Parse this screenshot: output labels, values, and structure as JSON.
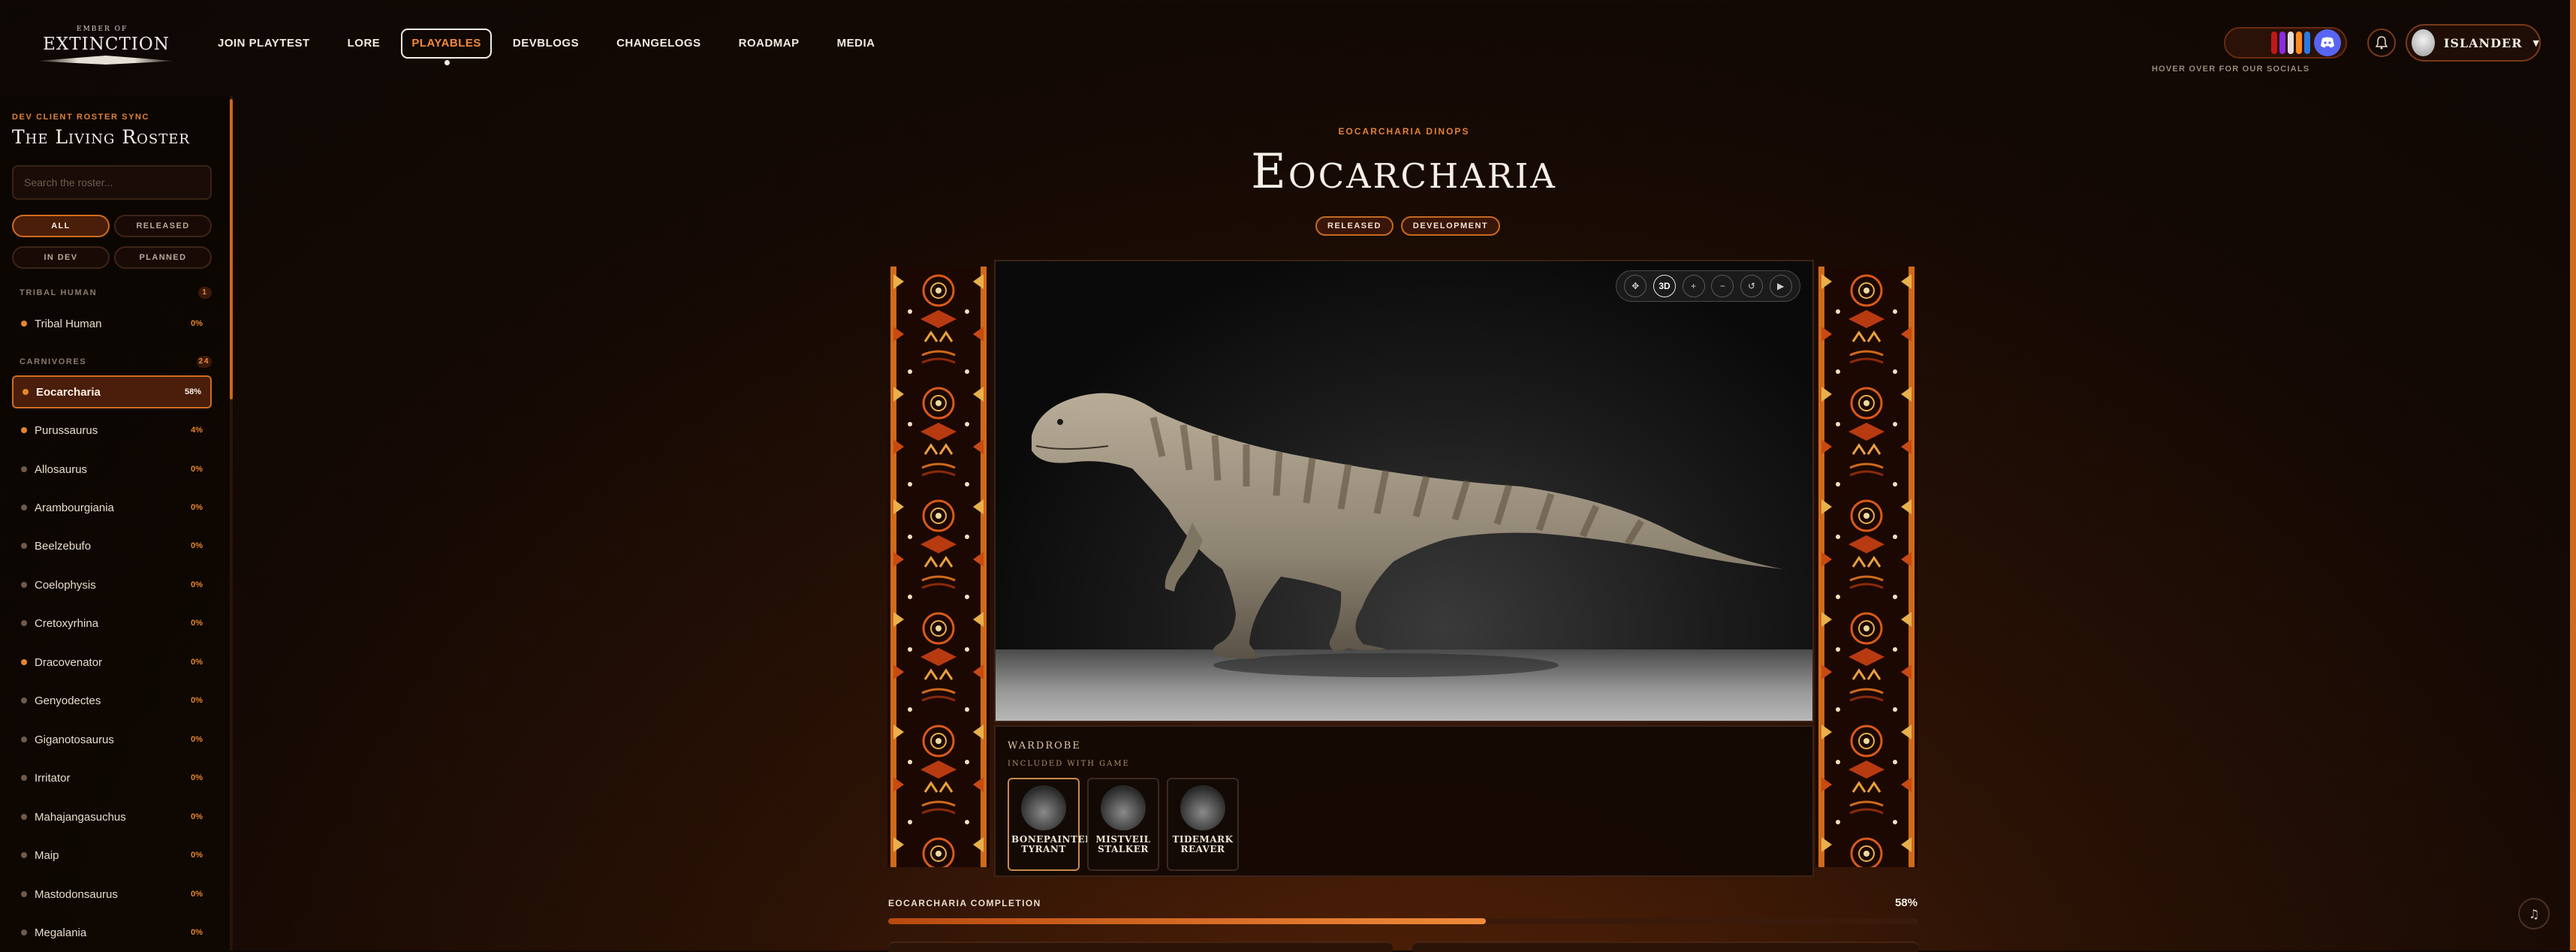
{
  "nav": {
    "logo_small": "EMBER OF",
    "logo_big": "EXTINCTION",
    "links": [
      "JOIN PLAYTEST",
      "LORE",
      "PLAYABLES",
      "DEVBLOGS",
      "CHANGELOGS",
      "ROADMAP",
      "MEDIA"
    ],
    "active": "PLAYABLES",
    "socials_hint": "HOVER OVER FOR OUR SOCIALS",
    "user_name": "ISLANDER"
  },
  "sidebar": {
    "eyebrow": "DEV CLIENT ROSTER SYNC",
    "title": "The Living Roster",
    "search_placeholder": "Search the roster...",
    "filters": [
      "ALL",
      "RELEASED",
      "IN DEV",
      "PLANNED"
    ],
    "active_filter": "ALL",
    "categories": [
      {
        "name": "TRIBAL HUMAN",
        "count": "1"
      },
      {
        "name": "CARNIVORES",
        "count": "24"
      }
    ],
    "items": [
      {
        "name": "Tribal Human",
        "pct": "0%",
        "dot": "orange"
      },
      {
        "name": "Eocarcharia",
        "pct": "58%",
        "dot": "orange",
        "active": true
      },
      {
        "name": "Purussaurus",
        "pct": "4%",
        "dot": "orange"
      },
      {
        "name": "Allosaurus",
        "pct": "0%",
        "dot": "grey"
      },
      {
        "name": "Arambourgiania",
        "pct": "0%",
        "dot": "grey"
      },
      {
        "name": "Beelzebufo",
        "pct": "0%",
        "dot": "grey"
      },
      {
        "name": "Coelophysis",
        "pct": "0%",
        "dot": "grey"
      },
      {
        "name": "Cretoxyrhina",
        "pct": "0%",
        "dot": "grey"
      },
      {
        "name": "Dracovenator",
        "pct": "0%",
        "dot": "orange"
      },
      {
        "name": "Genyodectes",
        "pct": "0%",
        "dot": "grey"
      },
      {
        "name": "Giganotosaurus",
        "pct": "0%",
        "dot": "grey"
      },
      {
        "name": "Irritator",
        "pct": "0%",
        "dot": "grey"
      },
      {
        "name": "Mahajangasuchus",
        "pct": "0%",
        "dot": "grey"
      },
      {
        "name": "Maip",
        "pct": "0%",
        "dot": "grey"
      },
      {
        "name": "Mastodonsaurus",
        "pct": "0%",
        "dot": "grey"
      },
      {
        "name": "Megalania",
        "pct": "0%",
        "dot": "grey"
      }
    ]
  },
  "main": {
    "eyebrow": "EOCARCHARIA DINOPS",
    "title": "Eocarcharia",
    "tags": [
      "RELEASED",
      "DEVELOPMENT"
    ],
    "viewer_controls": [
      "✥",
      "3D",
      "+",
      "−",
      "↺",
      "▶"
    ],
    "wardrobe_title": "WARDROBE",
    "wardrobe_subtitle": "INCLUDED WITH GAME",
    "skins": [
      {
        "name": "BONEPAINTED TYRANT",
        "active": true
      },
      {
        "name": "MISTVEIL STALKER"
      },
      {
        "name": "TIDEMARK REAVER"
      }
    ],
    "progress_label": "EOCARCHARIA COMPLETION",
    "progress_value": "58%",
    "progress_fraction": 0.58
  },
  "colors": {
    "accent": "#e7852e",
    "accent_dark": "#4a1e0a",
    "discord": "#5865f2"
  },
  "icons": {
    "bell": "bell-icon",
    "music": "music-note-icon",
    "chevron": "chevron-down-icon"
  }
}
